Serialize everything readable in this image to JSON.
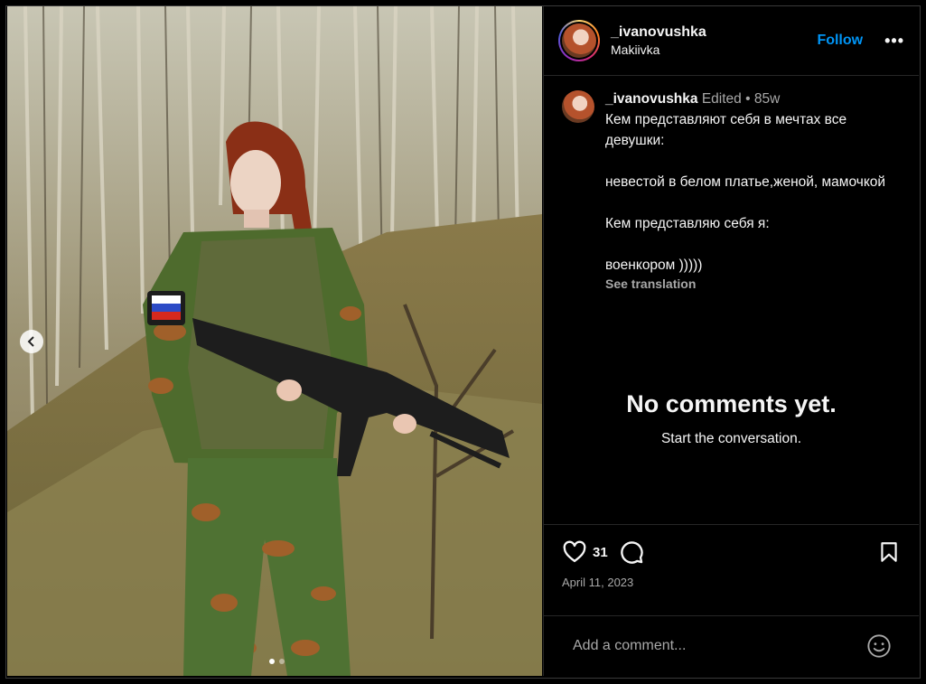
{
  "post": {
    "username": "_ivanovushka",
    "location": "Makiivka",
    "follow_label": "Follow",
    "more_label": "•••"
  },
  "caption": {
    "username": "_ivanovushka",
    "edited": "Edited",
    "separator": "•",
    "age": "85w",
    "lines": [
      "Кем представляют себя в мечтах все девушки:",
      "",
      "невестой в белом платье,женой, мамочкой",
      "",
      "Кем представляю себя я:",
      "",
      "военкором )))))"
    ],
    "see_translation": "See translation"
  },
  "comments": {
    "empty_title": "No comments yet.",
    "empty_subtitle": "Start the conversation."
  },
  "actions": {
    "likes": "31",
    "date": "April 11, 2023"
  },
  "comment_box": {
    "placeholder": "Add a comment..."
  },
  "carousel": {
    "slide_count": 2,
    "active_index": 0
  },
  "icons": {
    "like": "heart-icon",
    "comment": "comment-icon",
    "save": "bookmark-icon",
    "emoji": "emoji-icon",
    "prev": "chevron-left-icon"
  },
  "colors": {
    "background": "#000000",
    "accent": "#0095f6",
    "muted": "#a8a8a8"
  }
}
